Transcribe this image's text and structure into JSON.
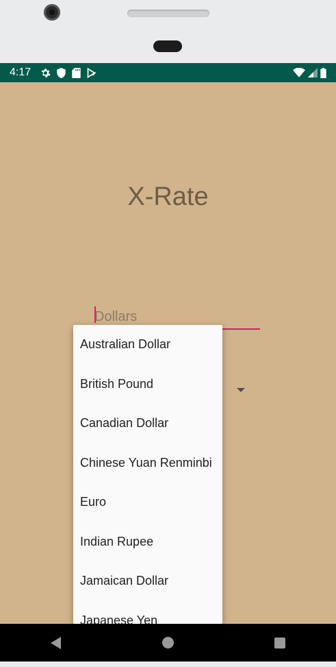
{
  "status_bar": {
    "time": "4:17",
    "icons_left": [
      "settings-icon",
      "shield-icon",
      "sd-card-icon",
      "play-protect-icon"
    ],
    "icons_right": [
      "wifi-icon",
      "signal-icon",
      "battery-icon"
    ],
    "background": "#045a4a"
  },
  "app": {
    "title": "X-Rate",
    "background": "#d2b48c",
    "amount_input": {
      "placeholder": "Dollars",
      "value": ""
    }
  },
  "currency_dropdown": {
    "items": [
      "Australian Dollar",
      "British Pound",
      "Canadian Dollar",
      "Chinese Yuan Renminbi",
      "Euro",
      "Indian Rupee",
      "Jamaican Dollar",
      "Japanese Yen"
    ]
  },
  "nav_bar": {
    "buttons": [
      "back-icon",
      "home-icon",
      "recents-icon"
    ]
  }
}
